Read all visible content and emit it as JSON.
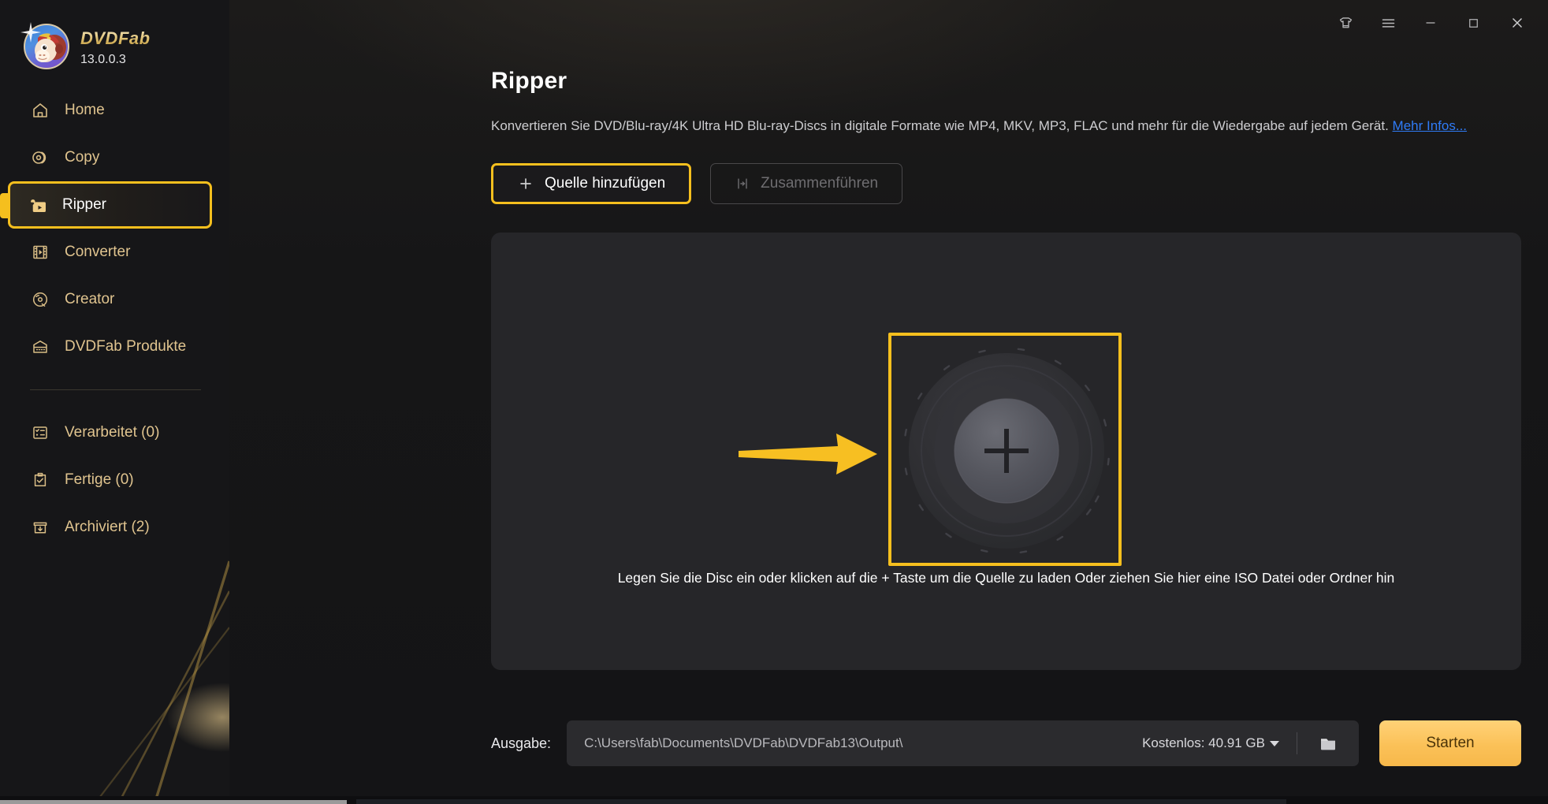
{
  "app": {
    "brand_name": "DVDFab",
    "version": "13.0.0.3"
  },
  "titlebar": {
    "theme_icon": "tshirt-icon",
    "menu_icon": "hamburger-menu-icon",
    "minimize_icon": "minimize-icon",
    "maximize_icon": "maximize-icon",
    "close_icon": "close-icon"
  },
  "sidebar": {
    "primary": [
      {
        "label": "Home",
        "icon": "home-icon",
        "active": false
      },
      {
        "label": "Copy",
        "icon": "disc-copy-icon",
        "active": false
      },
      {
        "label": "Ripper",
        "icon": "ripper-folder-icon",
        "active": true
      },
      {
        "label": "Converter",
        "icon": "film-strip-icon",
        "active": false
      },
      {
        "label": "Creator",
        "icon": "disc-creator-icon",
        "active": false
      },
      {
        "label": "DVDFab Produkte",
        "icon": "product-box-icon",
        "active": false
      }
    ],
    "secondary": [
      {
        "label": "Verarbeitet (0)",
        "icon": "task-list-icon"
      },
      {
        "label": "Fertige (0)",
        "icon": "clipboard-check-icon"
      },
      {
        "label": "Archiviert (2)",
        "icon": "archive-download-icon"
      }
    ]
  },
  "main": {
    "title": "Ripper",
    "description_text": "Konvertieren Sie DVD/Blu-ray/4K Ultra HD Blu-ray-Discs in digitale Formate wie MP4, MKV, MP3, FLAC und mehr für die Wiedergabe auf jedem Gerät. ",
    "description_link": "Mehr Infos...",
    "add_source_label": "Quelle hinzufügen",
    "add_source_icon": "plus-icon",
    "merge_label": "Zusammenführen",
    "merge_icon": "merge-icon",
    "drop_zone": {
      "plus_icon": "plus-icon",
      "hint": "Legen Sie die Disc ein oder klicken auf die + Taste um die Quelle zu laden Oder ziehen Sie hier eine ISO Datei oder Ordner hin",
      "arrow_icon": "arrow-right-annotation-icon"
    }
  },
  "output_bar": {
    "label": "Ausgabe:",
    "path": "C:\\Users\\fab\\Documents\\DVDFab\\DVDFab13\\Output\\",
    "free_space": "Kostenlos: 40.91 GB",
    "browse_icon": "folder-icon",
    "start_label": "Starten"
  },
  "colors": {
    "accent_yellow": "#f5bf1e",
    "start_button": "#fbc158",
    "sidebar_text": "#e0c48f",
    "link_blue": "#2f7bf6",
    "panel_bg": "#262629",
    "sidebar_bg": "#161618"
  }
}
